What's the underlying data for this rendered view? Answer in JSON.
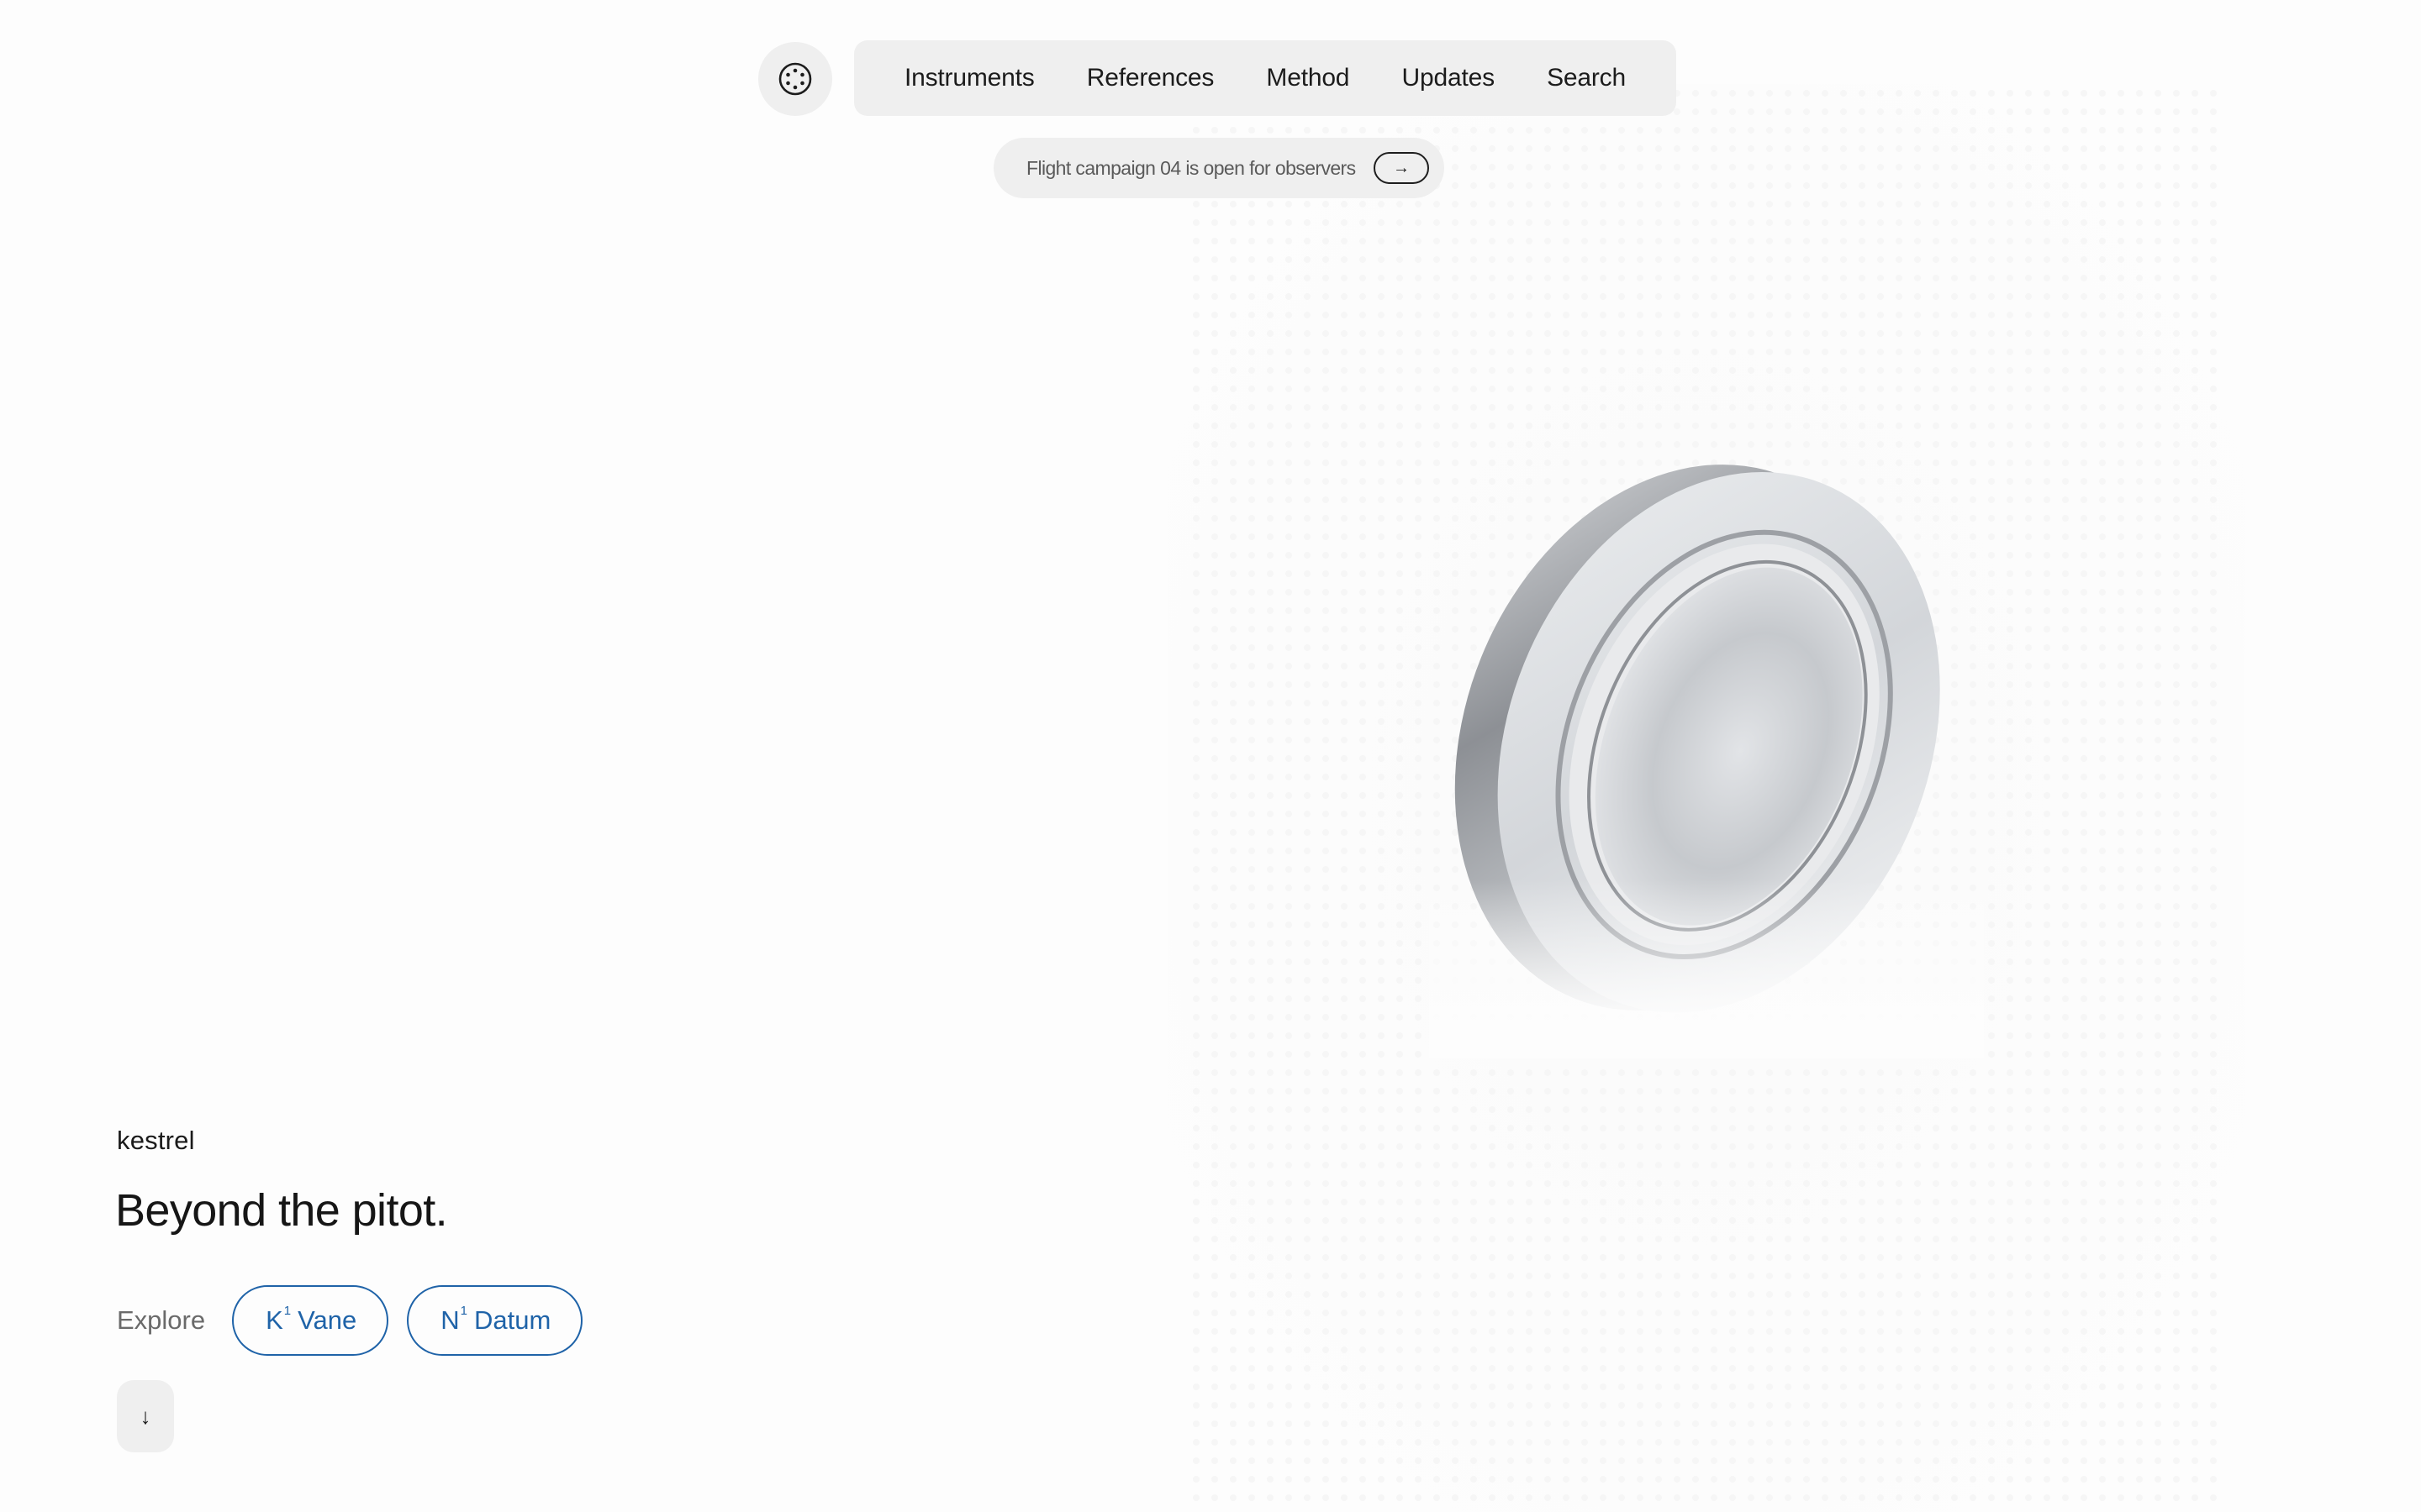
{
  "header": {
    "logo_icon": "dotted-circle-icon",
    "nav_items": [
      {
        "label": "Instruments"
      },
      {
        "label": "References"
      },
      {
        "label": "Method"
      },
      {
        "label": "Updates"
      },
      {
        "label": "Search"
      }
    ]
  },
  "announcement": {
    "text": "Flight campaign 04 is open for observers",
    "arrow_icon": "arrow-right-icon",
    "arrow_glyph": "→"
  },
  "hero": {
    "image": "metallic-disc-sensor",
    "brand": "kestrel",
    "headline": "Beyond the pitot.",
    "explore_label": "Explore",
    "links": [
      {
        "letter": "K",
        "sup": "1",
        "name": "Vane"
      },
      {
        "letter": "N",
        "sup": "1",
        "name": "Datum"
      }
    ],
    "scroll_icon": "arrow-down-icon",
    "scroll_glyph": "↓"
  },
  "colors": {
    "background": "#fdfdfd",
    "surface": "#efefef",
    "accent": "#1f63a8",
    "text": "#1b1b1b",
    "muted": "#6a6a6a"
  }
}
